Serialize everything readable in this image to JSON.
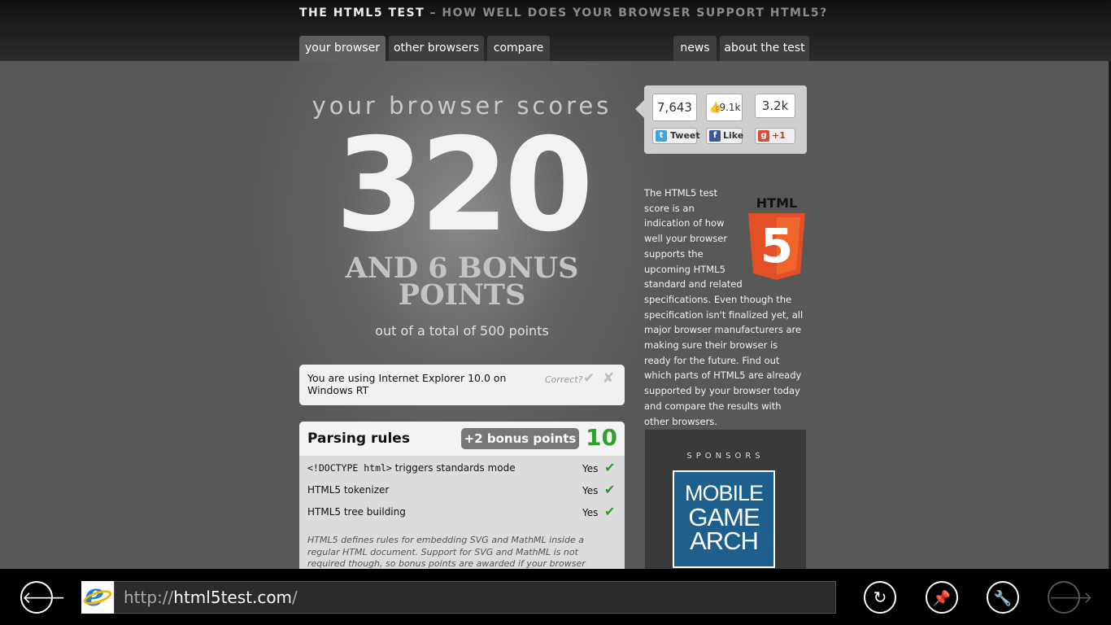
{
  "header": {
    "site_title": "THE HTML5 TEST",
    "site_subtitle": "– HOW WELL DOES YOUR BROWSER SUPPORT HTML5?",
    "tabs_left": [
      "your browser",
      "other browsers",
      "compare"
    ],
    "tabs_right": [
      "news",
      "about the test"
    ],
    "active_tab": "your browser"
  },
  "score": {
    "heading": "your browser scores",
    "value": "320",
    "bonus_line1": "AND 6 BONUS",
    "bonus_line2": "POINTS",
    "total": "out of a total of 500 points"
  },
  "user_agent": {
    "text": "You are using Internet Explorer 10.0 on Windows RT",
    "correct_label": "Correct?",
    "confirm_icon": "checkmark-icon",
    "reject_icon": "x-icon"
  },
  "parsing": {
    "title": "Parsing rules",
    "bonus": "+2 bonus points",
    "score": "10",
    "rows": [
      {
        "code": "<!DOCTYPE html>",
        "text": " triggers standards mode",
        "result": "Yes"
      },
      {
        "code": "",
        "text": "HTML5 tokenizer",
        "result": "Yes"
      },
      {
        "code": "",
        "text": "HTML5 tree building",
        "result": "Yes"
      }
    ],
    "note": "HTML5 defines rules for embedding SVG and MathML inside a regular HTML document. Support for SVG and MathML is not required though, so bonus points are awarded if your browser supports embedding"
  },
  "social": {
    "tweet_count": "7,643",
    "tweet_label": "Tweet",
    "like_count": "9.1k",
    "like_label": "Like",
    "plus_count": "3.2k",
    "plus_label": "+1"
  },
  "description": "The HTML5 test score is an indication of how well your browser supports the upcoming HTML5 standard and related specifications. Even though the specification isn't finalized yet, all major browser manufacturers are making sure their browser is ready for the future. Find out which parts of HTML5 are already supported by your browser today and compare the results with other browsers.",
  "html5_logo": {
    "label": "HTML",
    "number": "5"
  },
  "sponsors": {
    "title": "SPONSORS",
    "ad_line1": "MOBILE",
    "ad_line2": "GAME",
    "ad_line3": "ARCH"
  },
  "appbar": {
    "url_prefix": "http://",
    "url_domain": "html5test.com",
    "url_suffix": "/",
    "icons": [
      "back-icon",
      "refresh-icon",
      "pin-icon",
      "tools-icon",
      "forward-icon"
    ]
  }
}
